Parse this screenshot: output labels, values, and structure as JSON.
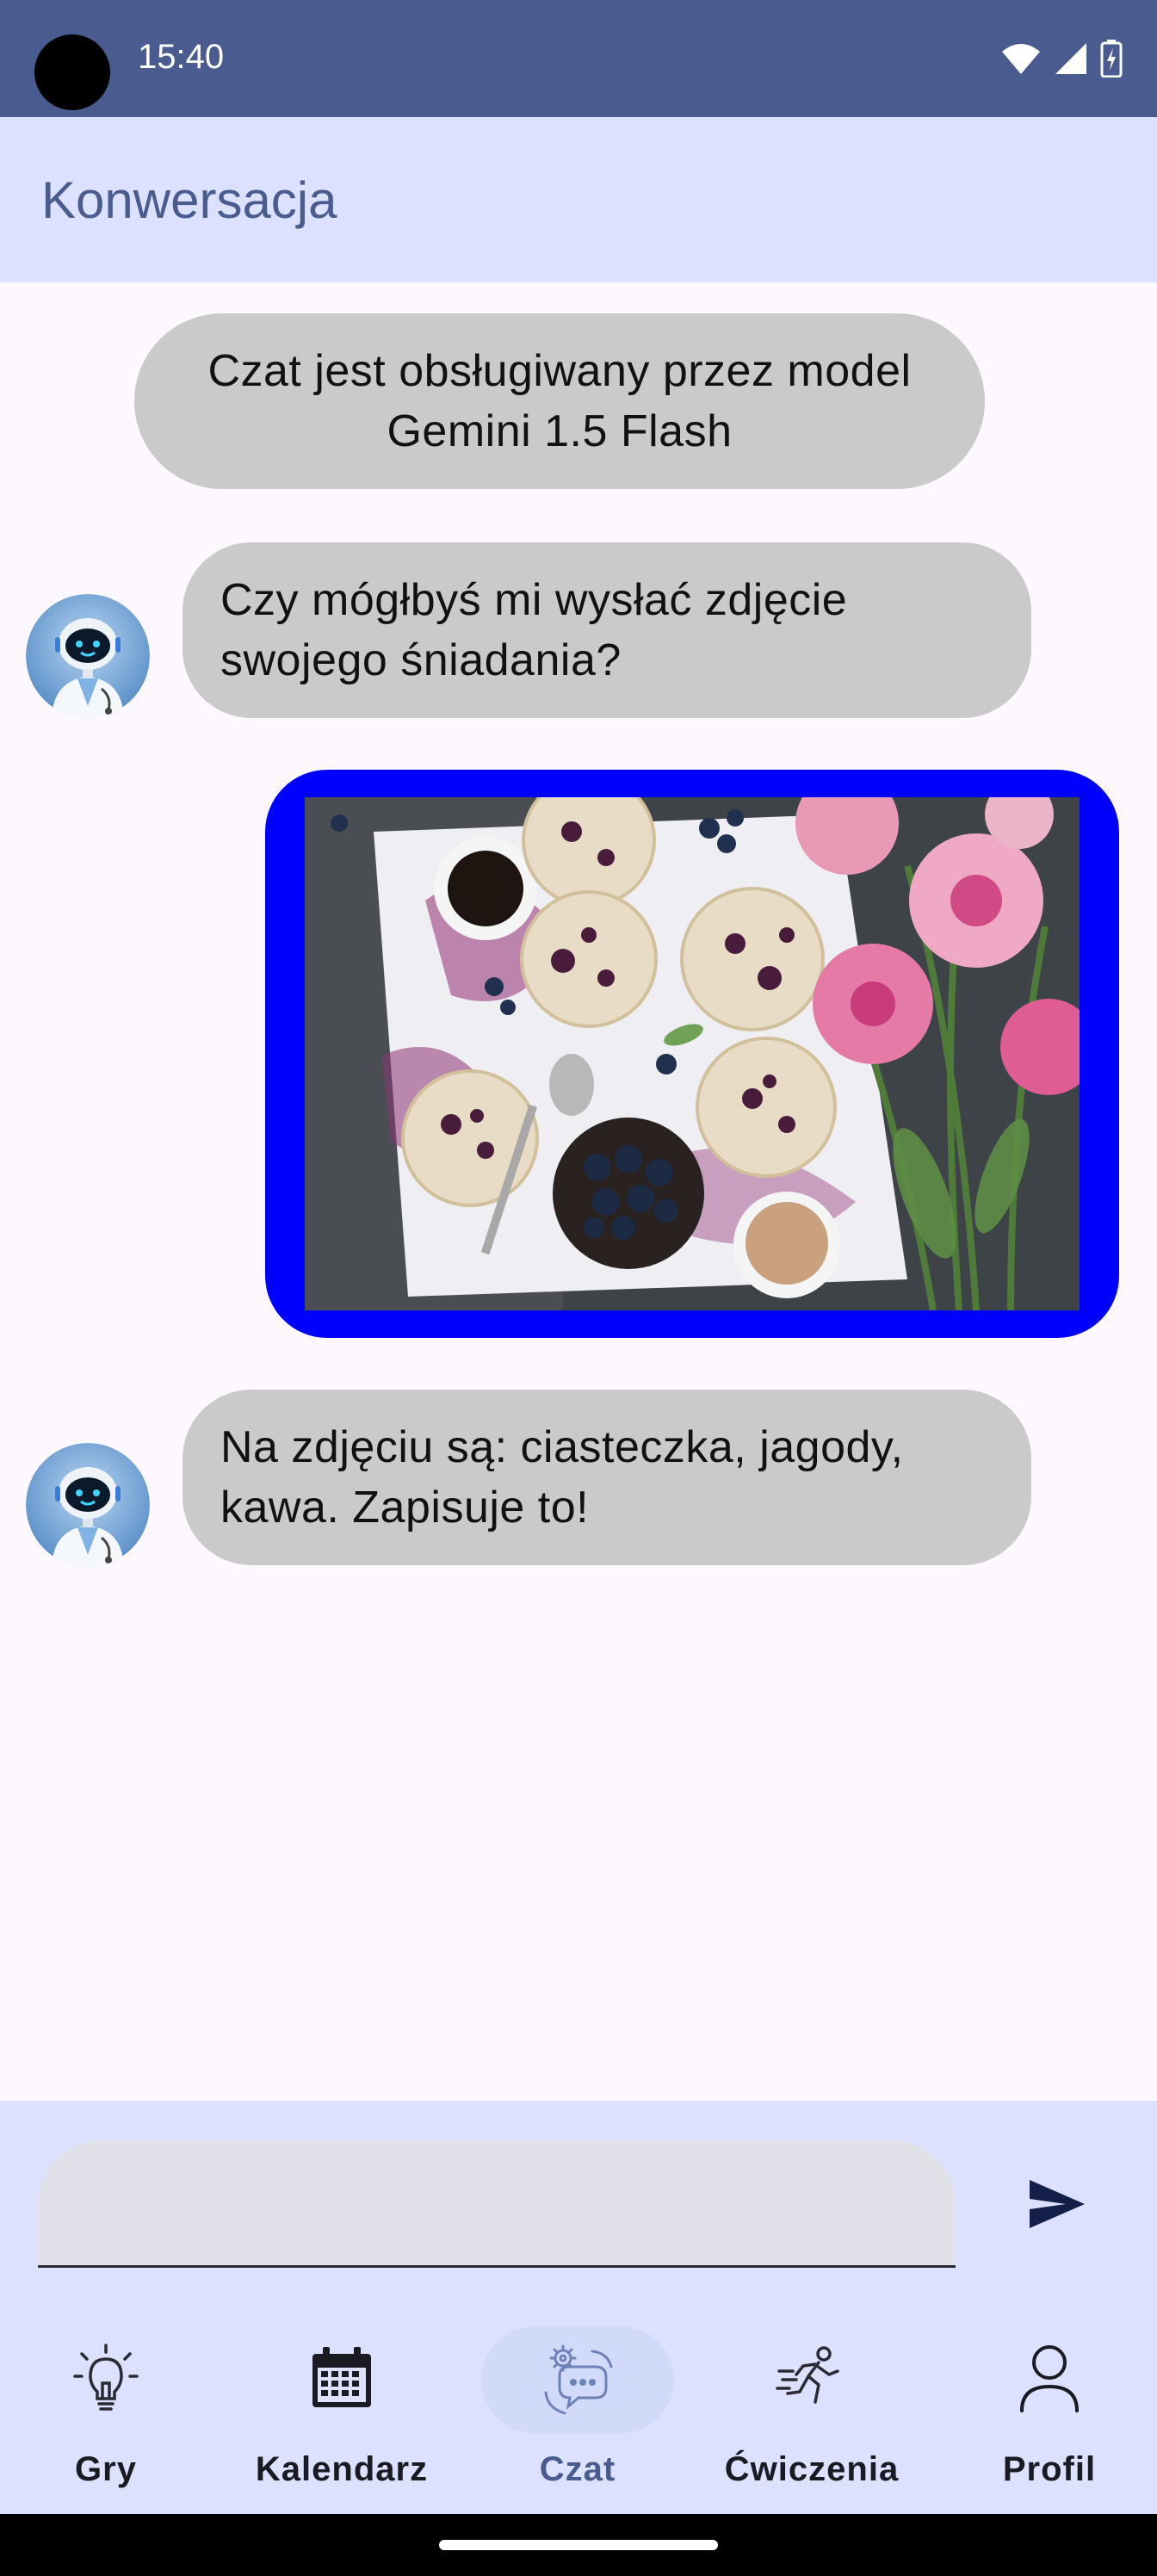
{
  "status_bar": {
    "time": "15:40"
  },
  "app_bar": {
    "title": "Konwersacja"
  },
  "chat": {
    "system_message": "Czat jest obsługiwany przez model Gemini 1.5 Flash",
    "messages": [
      {
        "sender": "bot",
        "text": "Czy mógłbyś mi wysłać zdjęcie swojego śniadania?"
      },
      {
        "sender": "user",
        "type": "image"
      },
      {
        "sender": "bot",
        "text": "Na zdjęciu są: ciasteczka, jagody, kawa. Zapisuje to!"
      }
    ]
  },
  "input": {
    "value": "",
    "placeholder": ""
  },
  "nav": {
    "items": [
      {
        "label": "Gry",
        "icon": "lightbulb-icon"
      },
      {
        "label": "Kalendarz",
        "icon": "calendar-icon"
      },
      {
        "label": "Czat",
        "icon": "chat-icon",
        "active": true
      },
      {
        "label": "Ćwiczenia",
        "icon": "running-icon"
      },
      {
        "label": "Profil",
        "icon": "person-icon"
      }
    ]
  },
  "colors": {
    "status_bar": "#4a5b8f",
    "app_bar": "#dbe1ff",
    "bubble": "#cacaca",
    "image_border": "#0000ff",
    "accent": "#4a5b8f"
  }
}
